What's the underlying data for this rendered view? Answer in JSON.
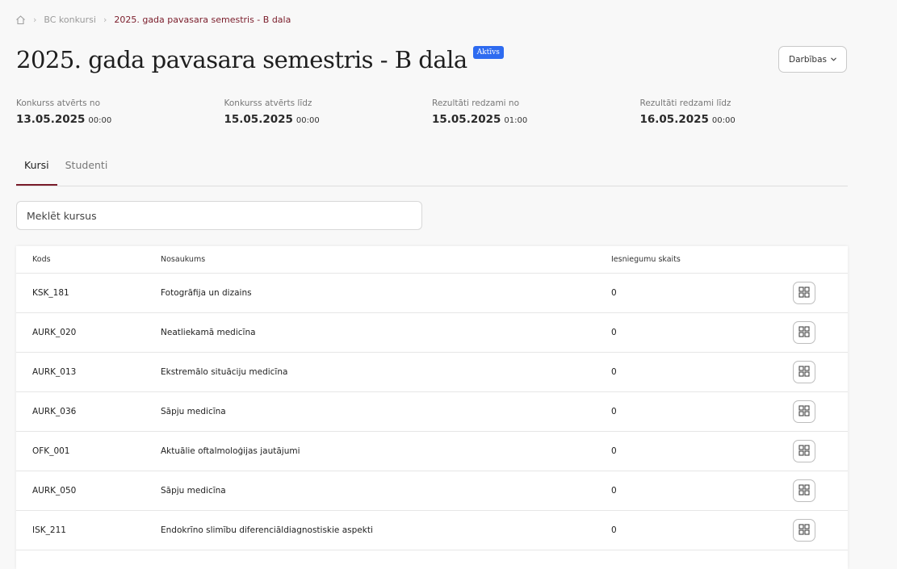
{
  "breadcrumb": {
    "home_icon": "home-icon",
    "items": [
      "BC konkursi",
      "2025. gada pavasara semestris - B dala"
    ]
  },
  "header": {
    "title": "2025. gada pavasara semestris - B dala",
    "status_badge": "Aktīvs",
    "actions_label": "Darbības"
  },
  "dates": [
    {
      "label": "Konkurss atvērts no",
      "date": "13.05.2025",
      "time": "00:00"
    },
    {
      "label": "Konkurss atvērts līdz",
      "date": "15.05.2025",
      "time": "00:00"
    },
    {
      "label": "Rezultāti redzami no",
      "date": "15.05.2025",
      "time": "01:00"
    },
    {
      "label": "Rezultāti redzami līdz",
      "date": "16.05.2025",
      "time": "00:00"
    }
  ],
  "tabs": [
    {
      "label": "Kursi",
      "active": true
    },
    {
      "label": "Studenti",
      "active": false
    }
  ],
  "search": {
    "placeholder": "Meklēt kursus",
    "value": ""
  },
  "table": {
    "columns": [
      "Kods",
      "Nosaukums",
      "Iesniegumu skaits"
    ],
    "rows": [
      {
        "code": "KSK_181",
        "name": "Fotogrāfija un dizains",
        "count": "0"
      },
      {
        "code": "AURK_020",
        "name": "Neatliekamā medicīna",
        "count": "0"
      },
      {
        "code": "AURK_013",
        "name": "Ekstremālo situāciju medicīna",
        "count": "0"
      },
      {
        "code": "AURK_036",
        "name": "Sāpju medicīna",
        "count": "0"
      },
      {
        "code": "OFK_001",
        "name": "Aktuālie oftalmoloģijas jautājumi",
        "count": "0"
      },
      {
        "code": "AURK_050",
        "name": "Sāpju medicīna",
        "count": "0"
      },
      {
        "code": "ISK_211",
        "name": "Endokrīno slimību diferenciāldiagnostiskie aspekti",
        "count": "0"
      }
    ],
    "row_action_icon": "grid-icon"
  },
  "colors": {
    "accent": "#7a1c2a",
    "badge": "#2e6bf0"
  }
}
